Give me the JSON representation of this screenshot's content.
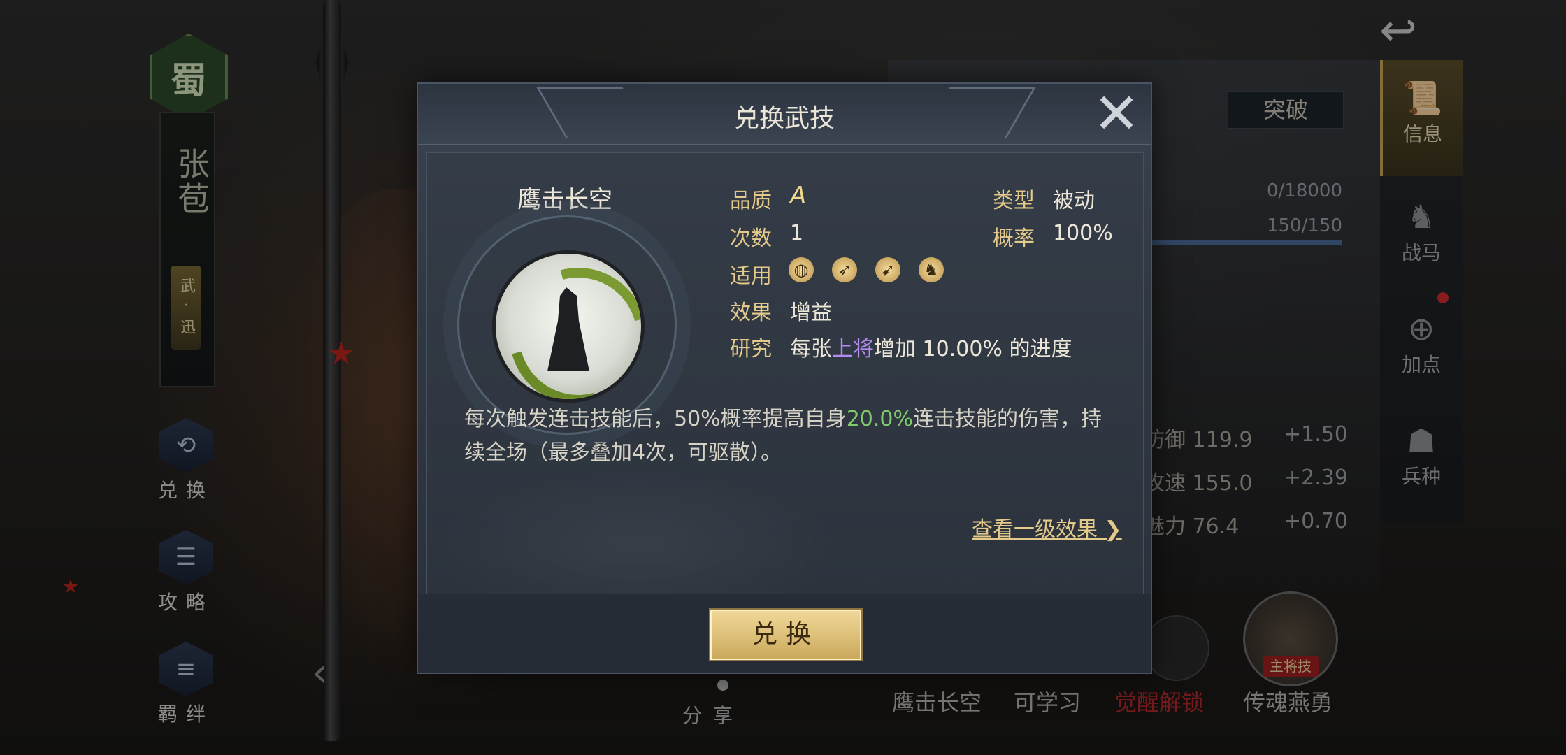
{
  "hero": {
    "faction": "蜀",
    "name": "张苞",
    "class": "武·迅",
    "side_buttons": [
      {
        "label": "兑换",
        "icon": "exchange-icon"
      },
      {
        "label": "攻略",
        "icon": "scroll-icon"
      },
      {
        "label": "羁绊",
        "icon": "bond-icon"
      }
    ],
    "share_label": "分享"
  },
  "right_panel": {
    "breakthrough_label": "突破",
    "exp": "0/18000",
    "troops": "150/150",
    "stats": [
      {
        "name": "防御",
        "value": "119.9",
        "plus": "+1.50"
      },
      {
        "name": "攻速",
        "value": "155.0",
        "plus": "+2.39"
      },
      {
        "name": "魅力",
        "value": "76.4",
        "plus": "+0.70"
      }
    ],
    "tabs": [
      {
        "label": "信息",
        "icon": "scroll-icon",
        "active": true
      },
      {
        "label": "战马",
        "icon": "horse-saddle-icon"
      },
      {
        "label": "加点",
        "icon": "armor-plus-icon"
      },
      {
        "label": "兵种",
        "icon": "soldier-icon"
      }
    ],
    "skills_bottom": [
      {
        "label": "鹰击长空",
        "color": "#b9b6ae"
      },
      {
        "label": "可学习",
        "color": "#b9b6ae"
      },
      {
        "label": "觉醒解锁",
        "color": "#b3282a"
      },
      {
        "label": "传魂燕勇",
        "color": "#b9b6ae"
      }
    ],
    "main_skill_tag": "主将技"
  },
  "modal": {
    "title": "兑换武技",
    "skill_name": "鹰击长空",
    "attributes": {
      "quality_label": "品质",
      "quality_value": "A",
      "type_label": "类型",
      "type_value": "被动",
      "count_label": "次数",
      "count_value": "1",
      "rate_label": "概率",
      "rate_value": "100%",
      "apply_label": "适用",
      "apply_icons": [
        "orb-weapon-icon",
        "bow-icon",
        "spear-icon",
        "horse-icon"
      ],
      "effect_label": "效果",
      "effect_value": "增益",
      "research_label": "研究",
      "research_prefix": "每张",
      "research_highlight": "上将",
      "research_suffix": "增加 10.00% 的进度"
    },
    "description": {
      "part1": "每次触发连击技能后，50%概率提高自身",
      "highlight": "20.0%",
      "part2": "连击技能的伤害，持续全场（最多叠加4次，可驱散）。"
    },
    "view_link": "查看一级效果",
    "exchange_button": "兑换"
  }
}
